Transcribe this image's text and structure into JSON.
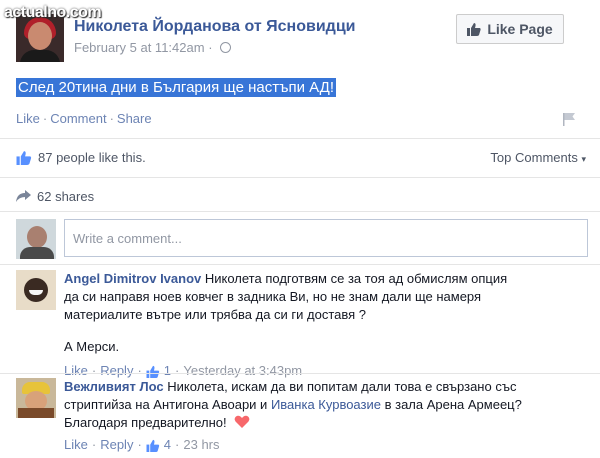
{
  "watermark": "actualno.com",
  "post": {
    "page_name": "Николета Йорданова от Ясновидци",
    "timestamp": "February 5 at 11:42am",
    "like_page_label": "Like Page",
    "text": "След 20тина дни в България ще настъпи АД!",
    "actions": {
      "like": "Like",
      "comment": "Comment",
      "share": "Share"
    }
  },
  "stats": {
    "likes_text": "87 people like this.",
    "top_comments_label": "Top Comments",
    "shares_text": "62 shares"
  },
  "composer": {
    "placeholder": "Write a comment..."
  },
  "comments": [
    {
      "author": "Angel Dimitrov Ivanov",
      "text_line1": "Николета подготвям се за тоя ад обмислям опция",
      "text_line2": "да си направя ноев ковчег в задника Ви, но не знам дали ще намеря",
      "text_line3": "материалите вътре или трябва да си ги доставя ?",
      "text_extra": "А Мерси.",
      "like_label": "Like",
      "reply_label": "Reply",
      "like_count": "1",
      "time": "Yesterday at 3:43pm"
    },
    {
      "author": "Вежливият Лос",
      "text_part1": "Николета, искам да ви попитам дали това е свързано със",
      "text_part2": "стриптийза на Антигона Авоари и",
      "mention": "Иванка Курвоазие",
      "text_part3": "в зала Арена Армеец?",
      "text_line3": "Благодаря предварително!",
      "like_label": "Like",
      "reply_label": "Reply",
      "like_count": "4",
      "time": "23 hrs"
    }
  ],
  "colors": {
    "link_blue": "#3b5998",
    "highlight": "#3875d7",
    "muted": "#9197a3",
    "heart": "#f7686b"
  }
}
